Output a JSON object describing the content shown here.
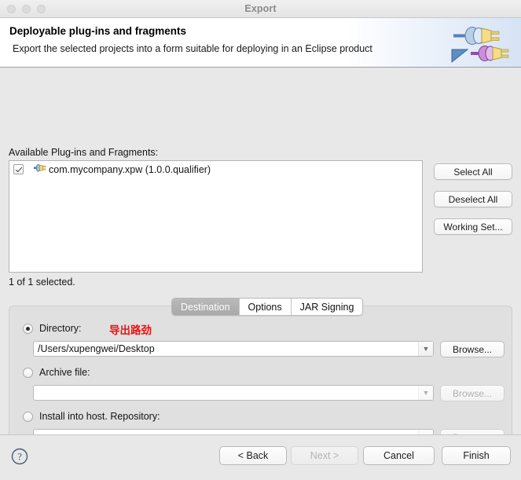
{
  "window": {
    "title": "Export",
    "traffic_lights": [
      "close",
      "minimize",
      "zoom"
    ]
  },
  "header": {
    "title": "Deployable plug-ins and fragments",
    "subtitle": "Export the selected projects into a form suitable for deploying in an Eclipse product",
    "icon": "eclipse-plug-in-export-icon"
  },
  "plugins_section": {
    "label": "Available Plug-ins and Fragments:",
    "items": [
      {
        "checked": true,
        "name": "com.mycompany.xpw (1.0.0.qualifier)",
        "icon": "plug-icon"
      }
    ],
    "status": "1 of 1 selected.",
    "buttons": [
      {
        "label": "Select All",
        "name": "select-all-button"
      },
      {
        "label": "Deselect All",
        "name": "deselect-all-button"
      },
      {
        "label": "Working Set...",
        "name": "working-set-button"
      }
    ]
  },
  "tabs": [
    {
      "label": "Destination",
      "active": true
    },
    {
      "label": "Options",
      "active": false
    },
    {
      "label": "JAR Signing",
      "active": false
    }
  ],
  "destination": {
    "directory": {
      "label": "Directory:",
      "selected": true,
      "value": "/Users/xupengwei/Desktop",
      "browse_label": "Browse...",
      "browse_disabled": false
    },
    "archive": {
      "label": "Archive file:",
      "selected": false,
      "value": "",
      "browse_label": "Browse...",
      "browse_disabled": true
    },
    "install_host": {
      "label": "Install into host. Repository:",
      "selected": false,
      "value": "",
      "browse_label": "Browse...",
      "browse_disabled": true
    },
    "annotation": {
      "text": "导出路劲",
      "color": "#ee1111"
    }
  },
  "footer": {
    "help_label": "?",
    "buttons": [
      {
        "label": "< Back",
        "name": "back-button",
        "disabled": false
      },
      {
        "label": "Next >",
        "name": "next-button",
        "disabled": true
      },
      {
        "label": "Cancel",
        "name": "cancel-button",
        "disabled": false
      },
      {
        "label": "Finish",
        "name": "finish-button",
        "disabled": false
      }
    ]
  }
}
